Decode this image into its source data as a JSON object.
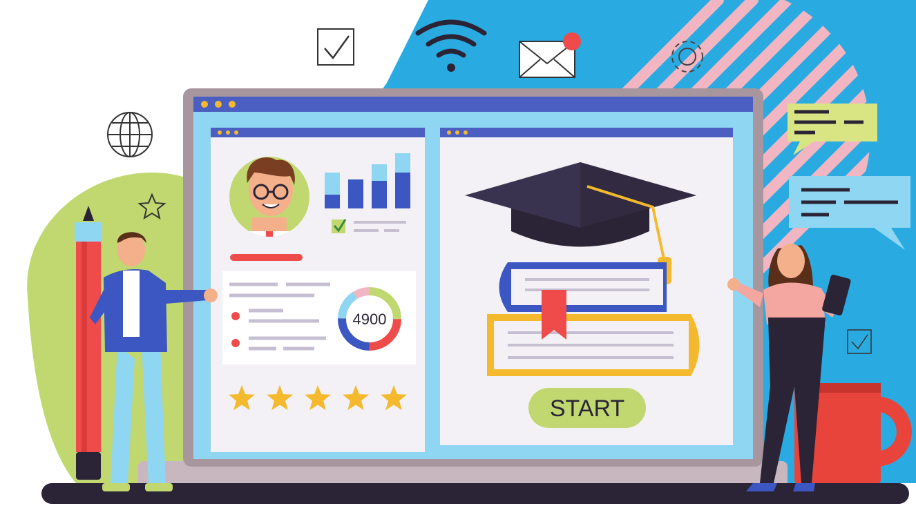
{
  "profile_panel": {
    "score_value": "4900",
    "rating_stars": 5,
    "rating_max": 5
  },
  "course_panel": {
    "start_label": "START"
  },
  "colors": {
    "sky": "#29abe2",
    "laptop_frame": "#a8969f",
    "window_bar": "#4a5fc1",
    "screen_bg": "#8fd6f2",
    "panel_bg": "#f3f1f6",
    "green_blob": "#c1d870",
    "accent_red": "#ef4b4b",
    "star": "#f5b92e",
    "stripes": "#f2b6c3",
    "dark": "#2b2436"
  },
  "icons": [
    "checkbox-icon",
    "wifi-icon",
    "envelope-notification-icon",
    "gear-icon",
    "globe-icon",
    "star-outline-icon",
    "chat-bubble-icon",
    "graduation-cap-icon",
    "books-stack-icon",
    "donut-chart",
    "bar-chart",
    "coffee-mug",
    "pencil"
  ]
}
